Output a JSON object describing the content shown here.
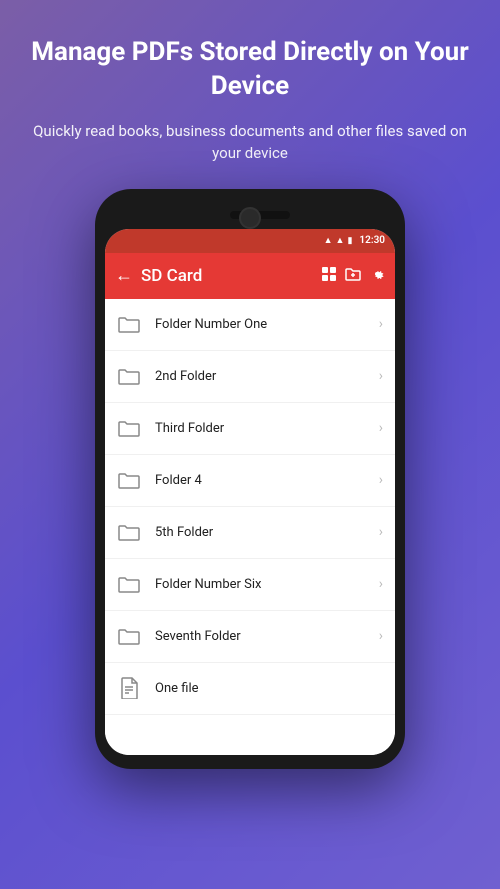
{
  "header": {
    "title": "Manage PDFs Stored Directly on Your Device",
    "subtitle": "Quickly read books, business documents and other files saved on your device"
  },
  "statusBar": {
    "time": "12:30",
    "icons": [
      "wifi",
      "signal",
      "battery"
    ]
  },
  "appBar": {
    "backLabel": "←",
    "title": "SD Card",
    "actions": [
      "grid",
      "folder-add",
      "settings"
    ]
  },
  "fileList": [
    {
      "type": "folder",
      "name": "Folder Number One"
    },
    {
      "type": "folder",
      "name": "2nd Folder"
    },
    {
      "type": "folder",
      "name": "Third Folder"
    },
    {
      "type": "folder",
      "name": "Folder 4"
    },
    {
      "type": "folder",
      "name": "5th Folder"
    },
    {
      "type": "folder",
      "name": "Folder Number Six"
    },
    {
      "type": "folder",
      "name": "Seventh Folder"
    },
    {
      "type": "file",
      "name": "One file"
    }
  ]
}
